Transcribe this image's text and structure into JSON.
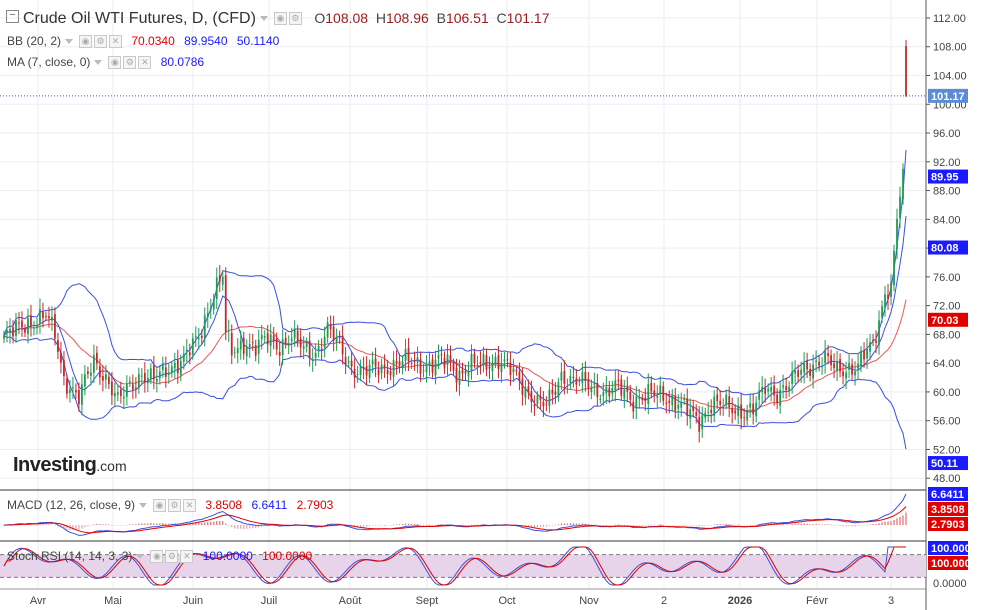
{
  "header": {
    "title": "Crude Oil WTI Futures, D, (CFD)",
    "o_label": "O",
    "o_value": "108.08",
    "h_label": "H",
    "h_value": "108.96",
    "l_label": "B",
    "l_value": "106.51",
    "c_label": "C",
    "c_value": "101.17"
  },
  "indicators": {
    "bb": {
      "label": "BB (20, 2)",
      "v1": "70.0340",
      "v2": "89.9540",
      "v3": "50.1140",
      "c1": "#e00000",
      "c2": "#1a1aff",
      "c3": "#1a1aff"
    },
    "ma": {
      "label": "MA (7, close, 0)",
      "v1": "80.0786",
      "c1": "#1a1aff"
    },
    "macd": {
      "label": "MACD (12, 26, close, 9)",
      "v1": "3.8508",
      "v2": "6.6411",
      "v3": "2.7903",
      "c1": "#e00000",
      "c2": "#1a1aff",
      "c3": "#e00000"
    },
    "stoch": {
      "label": "Stoch RSI (14, 14, 3, 3)",
      "v1": "100.0000",
      "v2": "100.0000",
      "c1": "#1a1aff",
      "c2": "#e00000"
    }
  },
  "logo": {
    "text": "Investing",
    "suffix": ".com"
  },
  "colors": {
    "up": "#1e9a52",
    "down": "#c62828",
    "bb_band": "#3b4fe0",
    "bb_mid": "#ee5555",
    "ma": "#3b4fe0",
    "price_line": "#3355cc",
    "stoch_fill": "#e7d4ea"
  },
  "chart_data": {
    "type": "candlestick",
    "x_labels": [
      "Avr",
      "Mai",
      "Juin",
      "Juil",
      "Août",
      "Sept",
      "Oct",
      "Nov",
      "2",
      "2026",
      "Févr",
      "3"
    ],
    "y_ticks": [
      "112.00",
      "108.00",
      "104.00",
      "100.00",
      "96.00",
      "92.00",
      "88.00",
      "84.00",
      "80.00",
      "76.00",
      "72.00",
      "68.00",
      "64.00",
      "60.00",
      "56.00",
      "52.00",
      "48.00"
    ],
    "ylim": [
      46.5,
      114.5
    ],
    "price_tags": [
      {
        "value": 101.17,
        "text": "101.17",
        "color": "#5b8cd6"
      },
      {
        "value": 89.95,
        "text": "89.95",
        "color": "#1a1aff"
      },
      {
        "value": 80.08,
        "text": "80.08",
        "color": "#1a1aff"
      },
      {
        "value": 70.03,
        "text": "70.03",
        "color": "#e00000"
      },
      {
        "value": 50.11,
        "text": "50.11",
        "color": "#1a1aff"
      }
    ],
    "close_anchors": [
      [
        0,
        67.5
      ],
      [
        7,
        69.5
      ],
      [
        14,
        70.5
      ],
      [
        17,
        68.0
      ],
      [
        20,
        62.0
      ],
      [
        25,
        59.0
      ],
      [
        30,
        64.5
      ],
      [
        34,
        62.0
      ],
      [
        38,
        58.5
      ],
      [
        42,
        61.0
      ],
      [
        46,
        62.5
      ],
      [
        50,
        61.5
      ],
      [
        55,
        63.5
      ],
      [
        60,
        64.5
      ],
      [
        65,
        67.5
      ],
      [
        70,
        74.0
      ],
      [
        73,
        76.0
      ],
      [
        74,
        68.0
      ],
      [
        76,
        65.5
      ],
      [
        80,
        67.0
      ],
      [
        84,
        66.0
      ],
      [
        88,
        67.5
      ],
      [
        92,
        66.5
      ],
      [
        96,
        67.5
      ],
      [
        100,
        66.0
      ],
      [
        104,
        65.5
      ],
      [
        108,
        68.5
      ],
      [
        112,
        66.5
      ],
      [
        116,
        63.5
      ],
      [
        120,
        62.5
      ],
      [
        124,
        63.5
      ],
      [
        130,
        63.5
      ],
      [
        136,
        64.5
      ],
      [
        142,
        63.5
      ],
      [
        148,
        64.5
      ],
      [
        152,
        62.5
      ],
      [
        156,
        63.5
      ],
      [
        160,
        64.0
      ],
      [
        165,
        64.5
      ],
      [
        170,
        62.5
      ],
      [
        174,
        60.5
      ],
      [
        178,
        58.5
      ],
      [
        181,
        58.0
      ],
      [
        184,
        60.5
      ],
      [
        186,
        62.5
      ],
      [
        190,
        61.5
      ],
      [
        195,
        61.0
      ],
      [
        200,
        60.0
      ],
      [
        205,
        60.5
      ],
      [
        210,
        59.0
      ],
      [
        215,
        59.5
      ],
      [
        220,
        59.5
      ],
      [
        225,
        58.5
      ],
      [
        230,
        56.5
      ],
      [
        232,
        56.0
      ],
      [
        236,
        58.5
      ],
      [
        240,
        58.0
      ],
      [
        244,
        57.5
      ],
      [
        250,
        57.5
      ],
      [
        254,
        60.5
      ],
      [
        258,
        60.0
      ],
      [
        262,
        61.0
      ],
      [
        266,
        63.0
      ],
      [
        270,
        64.0
      ],
      [
        274,
        64.5
      ],
      [
        278,
        63.0
      ],
      [
        282,
        63.5
      ],
      [
        285,
        63.5
      ],
      [
        287,
        65.0
      ],
      [
        290,
        66.5
      ],
      [
        292,
        70.0
      ],
      [
        294,
        74.0
      ],
      [
        296,
        75.0
      ],
      [
        298,
        84.0
      ],
      [
        300,
        90.5
      ]
    ],
    "last_candle": {
      "open": 108.08,
      "high": 108.96,
      "low": 101.0,
      "close": 101.17
    },
    "macd": {
      "ylim": [
        -3.5,
        8.0
      ]
    },
    "stoch_rsi": {
      "ylim": [
        0,
        100
      ],
      "bands": [
        20,
        80
      ],
      "y_ticks": [
        "100.0000",
        "0.0000"
      ]
    }
  }
}
